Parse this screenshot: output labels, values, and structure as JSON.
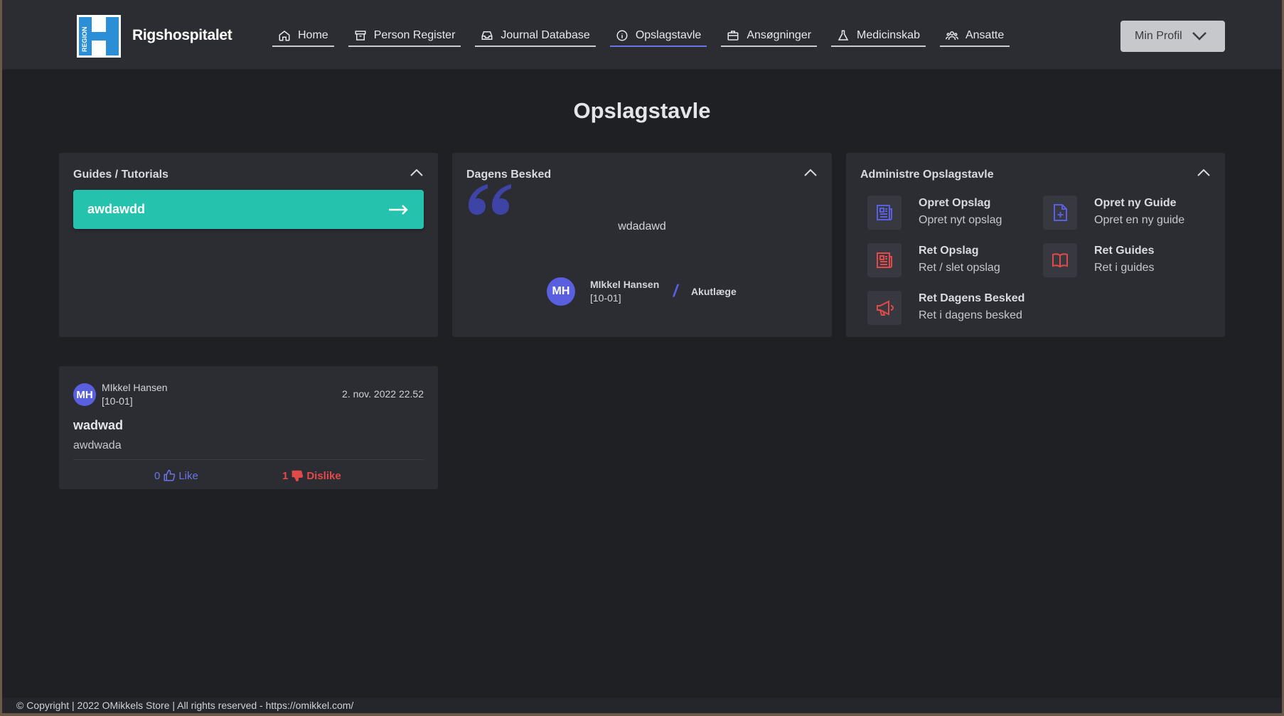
{
  "header": {
    "logo_text": "REGION",
    "brand": "Rigshospitalet",
    "nav": [
      {
        "label": "Home",
        "icon": "home-icon"
      },
      {
        "label": "Person Register",
        "icon": "archive-icon"
      },
      {
        "label": "Journal Database",
        "icon": "inbox-icon"
      },
      {
        "label": "Opslagstavle",
        "icon": "info-icon",
        "active": true
      },
      {
        "label": "Ansøgninger",
        "icon": "briefcase-icon"
      },
      {
        "label": "Medicinskab",
        "icon": "flask-icon"
      },
      {
        "label": "Ansatte",
        "icon": "users-icon"
      }
    ],
    "profile_label": "Min Profil"
  },
  "page": {
    "title": "Opslagstavle"
  },
  "guides": {
    "title": "Guides / Tutorials",
    "items": [
      {
        "label": "awdawdd"
      }
    ]
  },
  "motd": {
    "title": "Dagens Besked",
    "message": "wdadawd",
    "author": {
      "initials": "MH",
      "name": "MIkkel Hansen",
      "id": "[10-01]",
      "role": "Akutlæge"
    }
  },
  "admin": {
    "title": "Administre Opslagstavle",
    "items": [
      {
        "title": "Opret Opslag",
        "subtitle": "Opret nyt opslag",
        "icon": "newspaper-icon",
        "color": "#5a5fe0"
      },
      {
        "title": "Opret ny Guide",
        "subtitle": "Opret en ny guide",
        "icon": "file-plus-icon",
        "color": "#5a5fe0"
      },
      {
        "title": "Ret Opslag",
        "subtitle": "Ret / slet opslag",
        "icon": "newspaper-edit-icon",
        "color": "#e24a4a"
      },
      {
        "title": "Ret Guides",
        "subtitle": "Ret i guides",
        "icon": "book-icon",
        "color": "#e24a4a"
      },
      {
        "title": "Ret Dagens Besked",
        "subtitle": "Ret i dagens besked",
        "icon": "megaphone-icon",
        "color": "#e24a4a"
      }
    ]
  },
  "post": {
    "author": {
      "initials": "MH",
      "name": "MIkkel Hansen",
      "id": "[10-01]"
    },
    "date": "2. nov. 2022 22.52",
    "title": "wadwad",
    "body": "awdwada",
    "likes": "0",
    "like_label": "Like",
    "dislikes": "1",
    "dislike_label": "Dislike"
  },
  "footer": {
    "text": "© Copyright | 2022 OMikkels Store | All rights reserved - https://omikkel.com/"
  },
  "colors": {
    "accent": "#5a5fe0",
    "teal": "#25c3ad",
    "danger": "#e24a4a",
    "bg": "#1f2024",
    "card": "#2c2d33"
  }
}
